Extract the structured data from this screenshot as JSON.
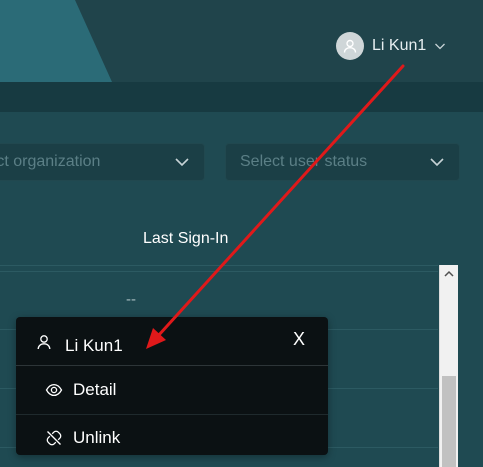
{
  "header": {
    "user_name": "Li Kun1",
    "user_menu_chevron": "chevron-down-icon",
    "avatar_icon": "user-avatar-icon"
  },
  "filters": {
    "organization_placeholder": "Select organization",
    "organization_visible": "elect organization",
    "status_placeholder": "Select user status"
  },
  "table": {
    "columns": [
      "Last Sign-In"
    ],
    "rows": [
      {
        "last_sign_in": "--"
      }
    ]
  },
  "popup": {
    "title": "Li Kun1",
    "close_label": "X",
    "items": [
      {
        "label": "Detail",
        "icon": "eye-icon"
      },
      {
        "label": "Unlink",
        "icon": "unlink-icon"
      }
    ]
  },
  "colors": {
    "background": "#1f4a52",
    "header_accent": "#2b6b77",
    "popup_background": "#0b1113",
    "annotation_arrow": "#e0191a"
  }
}
